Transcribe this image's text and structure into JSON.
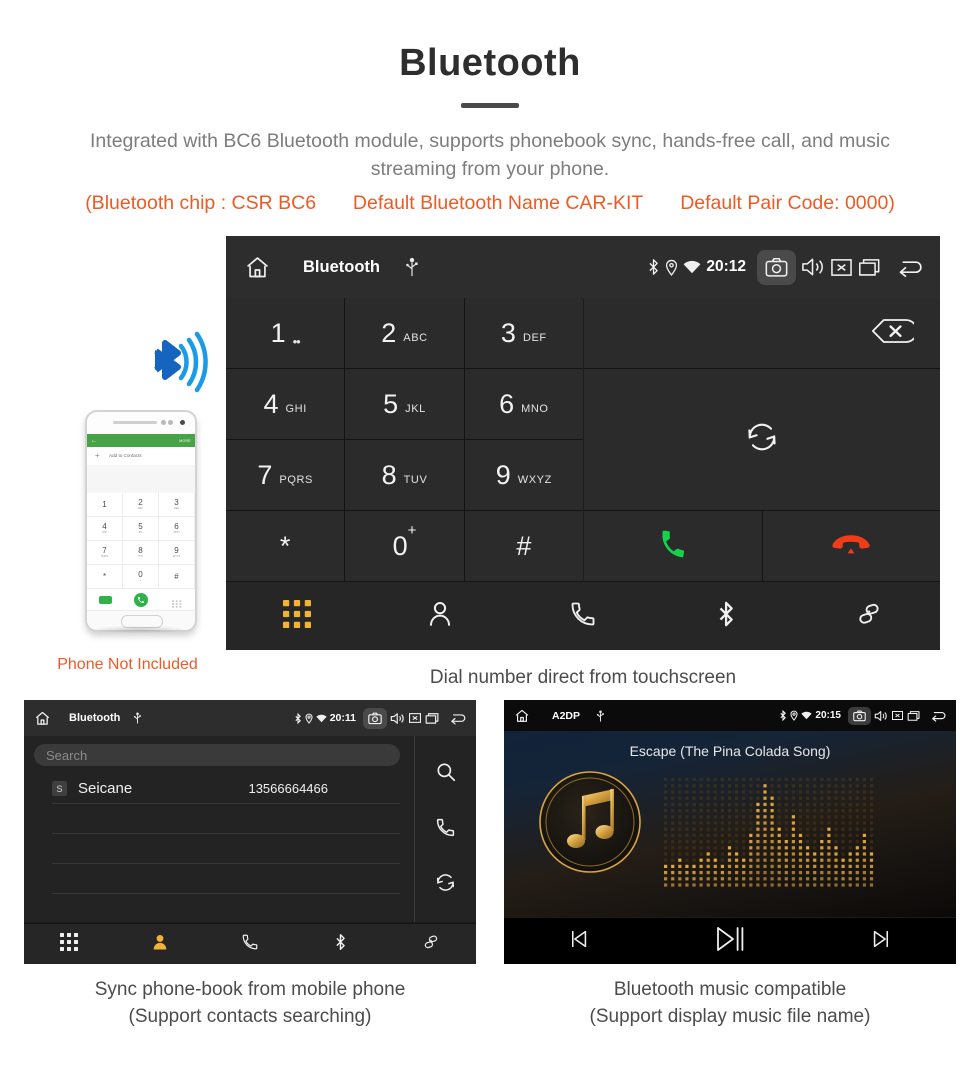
{
  "header": {
    "title": "Bluetooth",
    "subtitle": "Integrated with BC6 Bluetooth module, supports phonebook sync, hands-free call, and music streaming from your phone.",
    "spec_chip": "(Bluetooth chip : CSR BC6",
    "spec_name": "Default Bluetooth Name CAR-KIT",
    "spec_pair": "Default Pair Code: 0000)",
    "accent_color": "#ef5a22"
  },
  "phone_art": {
    "green_back": "←",
    "green_more": "MORE",
    "add_to_contacts": "Add to Contacts",
    "plus": "+",
    "keys": [
      {
        "num": "1",
        "sub": ""
      },
      {
        "num": "2",
        "sub": "ABC"
      },
      {
        "num": "3",
        "sub": "DEF"
      },
      {
        "num": "4",
        "sub": "GHI"
      },
      {
        "num": "5",
        "sub": "JKL"
      },
      {
        "num": "6",
        "sub": "MNO"
      },
      {
        "num": "7",
        "sub": "PQRS"
      },
      {
        "num": "8",
        "sub": "TUV"
      },
      {
        "num": "9",
        "sub": "WXYZ"
      },
      {
        "num": "*",
        "sub": ""
      },
      {
        "num": "0",
        "sub": "+"
      },
      {
        "num": "#",
        "sub": ""
      }
    ],
    "caption": "Phone Not Included"
  },
  "dialer": {
    "status": {
      "title": "Bluetooth",
      "time": "20:12",
      "icons": [
        "home-icon",
        "usb-icon",
        "bluetooth-icon",
        "location-icon",
        "wifi-icon",
        "camera-icon",
        "volume-icon",
        "close-icon",
        "recents-icon",
        "back-icon"
      ]
    },
    "keys": [
      {
        "num": "1",
        "sub": "∞",
        "sub_kind": "dots"
      },
      {
        "num": "2",
        "sub": "ABC",
        "sub_kind": "text"
      },
      {
        "num": "3",
        "sub": "DEF",
        "sub_kind": "text"
      },
      {
        "num": "4",
        "sub": "GHI",
        "sub_kind": "text"
      },
      {
        "num": "5",
        "sub": "JKL",
        "sub_kind": "text"
      },
      {
        "num": "6",
        "sub": "MNO",
        "sub_kind": "text"
      },
      {
        "num": "7",
        "sub": "PQRS",
        "sub_kind": "text"
      },
      {
        "num": "8",
        "sub": "TUV",
        "sub_kind": "text"
      },
      {
        "num": "9",
        "sub": "WXYZ",
        "sub_kind": "text"
      },
      {
        "num": "*",
        "sub": "",
        "sub_kind": "none"
      },
      {
        "num": "0",
        "sub": "+",
        "sub_kind": "sup"
      },
      {
        "num": "#",
        "sub": "",
        "sub_kind": "none"
      }
    ],
    "number_field_value": "",
    "actions": {
      "backspace": "backspace-icon",
      "sync": "sync-icon",
      "call": "call-icon",
      "hangup": "hangup-icon",
      "call_color": "#15d24a",
      "hangup_color": "#f03c18"
    },
    "nav": [
      {
        "name": "keypad",
        "icon": "keypad-icon",
        "active": true
      },
      {
        "name": "contacts",
        "icon": "contact-icon",
        "active": false
      },
      {
        "name": "call-log",
        "icon": "phone-icon",
        "active": false
      },
      {
        "name": "bluetooth",
        "icon": "bluetooth-icon",
        "active": false
      },
      {
        "name": "pair-link",
        "icon": "link-icon",
        "active": false
      }
    ],
    "active_color": "#f2b233",
    "caption": "Dial number direct from touchscreen"
  },
  "phonebook": {
    "status": {
      "title": "Bluetooth",
      "time": "20:11"
    },
    "search_placeholder": "Search",
    "contacts": [
      {
        "initial": "S",
        "name": "Seicane",
        "number": "13566664466"
      }
    ],
    "side_icons": [
      "search-icon",
      "phone-icon",
      "sync-icon"
    ],
    "nav": [
      {
        "name": "keypad",
        "icon": "keypad-icon",
        "active": false
      },
      {
        "name": "contacts",
        "icon": "contact-icon",
        "active": true
      },
      {
        "name": "call-log",
        "icon": "phone-icon",
        "active": false
      },
      {
        "name": "bluetooth",
        "icon": "bluetooth-icon",
        "active": false
      },
      {
        "name": "pair-link",
        "icon": "link-icon",
        "active": false
      }
    ],
    "caption_line1": "Sync phone-book from mobile phone",
    "caption_line2": "(Support contacts searching)"
  },
  "music": {
    "status": {
      "title": "A2DP",
      "time": "20:15"
    },
    "track_title": "Escape (The Pina Colada Song)",
    "controls": [
      {
        "name": "previous",
        "icon": "skip-previous-icon"
      },
      {
        "name": "play-pause",
        "icon": "play-pause-icon"
      },
      {
        "name": "next",
        "icon": "skip-next-icon"
      }
    ],
    "accent_color": "#d9a441",
    "caption_line1": "Bluetooth music compatible",
    "caption_line2": "(Support display music file name)"
  }
}
